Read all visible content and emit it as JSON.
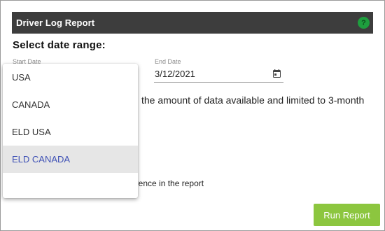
{
  "header": {
    "title": "Driver Log Report",
    "help_icon": "help-icon",
    "help_color": "#1e9e3e"
  },
  "heading": "Select date range:",
  "start_date": {
    "label": "Start Date"
  },
  "end_date": {
    "label": "End Date",
    "value": "3/12/2021",
    "icon": "calendar-icon"
  },
  "notice_text": "the amount of data available and limited to 3-month",
  "reference_text": "eference in the report",
  "run_button": {
    "label": "Run Report",
    "color": "#8cc63f"
  },
  "dropdown": {
    "options": [
      "USA",
      "CANADA",
      "ELD USA",
      "ELD CANADA"
    ],
    "selected": "ELD CANADA",
    "selected_color": "#3f51b5"
  }
}
